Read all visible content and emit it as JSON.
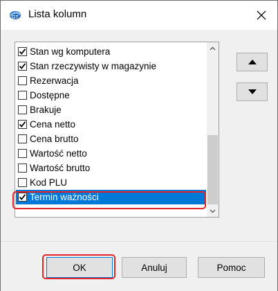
{
  "window": {
    "title": "Lista kolumn",
    "close_symbol": "✕"
  },
  "columns": [
    {
      "label": "Stan wg komputera",
      "checked": true
    },
    {
      "label": "Stan rzeczywisty w magazynie",
      "checked": true
    },
    {
      "label": "Rezerwacja",
      "checked": false
    },
    {
      "label": "Dostępne",
      "checked": false
    },
    {
      "label": "Brakuje",
      "checked": false
    },
    {
      "label": "Cena netto",
      "checked": true
    },
    {
      "label": "Cena brutto",
      "checked": false
    },
    {
      "label": "Wartość netto",
      "checked": false
    },
    {
      "label": "Wartość brutto",
      "checked": false
    },
    {
      "label": "Kod PLU",
      "checked": false
    },
    {
      "label": "Termin ważności",
      "checked": true,
      "selected": true
    }
  ],
  "side_buttons": {
    "up_icon": "arrow-up-icon",
    "down_icon": "arrow-down-icon"
  },
  "buttons": {
    "ok": "OK",
    "cancel": "Anuluj",
    "help": "Pomoc"
  },
  "colors": {
    "selection": "#0078d7",
    "highlight": "#e3242b"
  }
}
